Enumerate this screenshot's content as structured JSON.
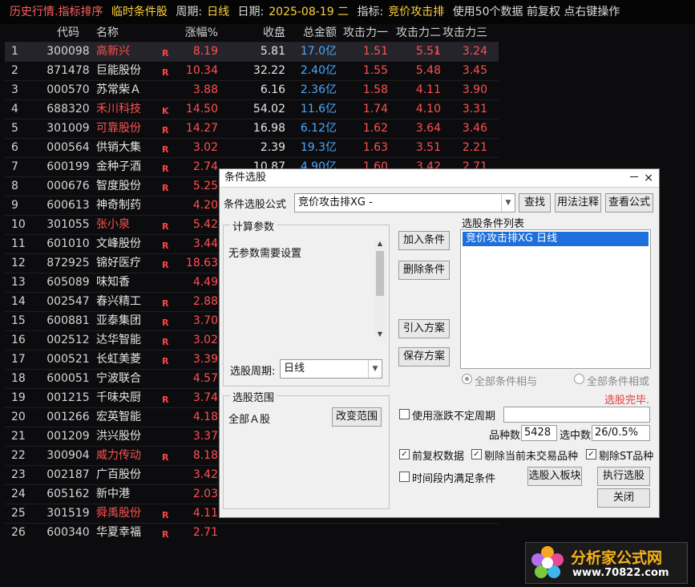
{
  "topbar": {
    "title": "历史行情.指标排序",
    "condition": "临时条件股",
    "period_label": "周期:",
    "period_value": "日线",
    "date_label": "日期:",
    "date_value": "2025-08-19 二",
    "indicator_label": "指标:",
    "indicator_value": "竞价攻击排",
    "info": "使用50个数据 前复权 点右键操作"
  },
  "table": {
    "headers": [
      "",
      "代码",
      "名称",
      "",
      "涨幅%",
      "收盘",
      "总金额",
      "攻击力一",
      "攻击力二",
      "攻击力三"
    ],
    "sort_arrow": "↓",
    "rows": [
      {
        "n": "1",
        "code": "300098",
        "name": "高新兴",
        "flag": "R",
        "chg": "8.19",
        "close": "5.81",
        "amt": "17.0亿",
        "a1": "1.51",
        "a2": "5.51",
        "a3": "3.24",
        "name_red": true
      },
      {
        "n": "2",
        "code": "871478",
        "name": "巨能股份",
        "flag": "R",
        "chg": "10.34",
        "close": "32.22",
        "amt": "2.40亿",
        "a1": "1.55",
        "a2": "5.48",
        "a3": "3.45",
        "name_red": false
      },
      {
        "n": "3",
        "code": "000570",
        "name": "苏常柴Ａ",
        "flag": "",
        "chg": "3.88",
        "close": "6.16",
        "amt": "2.36亿",
        "a1": "1.58",
        "a2": "4.11",
        "a3": "3.90",
        "name_red": false
      },
      {
        "n": "4",
        "code": "688320",
        "name": "禾川科技",
        "flag": "K",
        "chg": "14.50",
        "close": "54.02",
        "amt": "11.6亿",
        "a1": "1.74",
        "a2": "4.10",
        "a3": "3.31",
        "name_red": true
      },
      {
        "n": "5",
        "code": "301009",
        "name": "可靠股份",
        "flag": "R",
        "chg": "14.27",
        "close": "16.98",
        "amt": "6.12亿",
        "a1": "1.62",
        "a2": "3.64",
        "a3": "3.46",
        "name_red": true
      },
      {
        "n": "6",
        "code": "000564",
        "name": "供销大集",
        "flag": "R",
        "chg": "3.02",
        "close": "2.39",
        "amt": "19.3亿",
        "a1": "1.63",
        "a2": "3.51",
        "a3": "2.21",
        "name_red": false
      },
      {
        "n": "7",
        "code": "600199",
        "name": "金种子酒",
        "flag": "R",
        "chg": "2.74",
        "close": "10.87",
        "amt": "4.90亿",
        "a1": "1.60",
        "a2": "3.42",
        "a3": "2.71",
        "name_red": false
      },
      {
        "n": "8",
        "code": "000676",
        "name": "智度股份",
        "flag": "R",
        "chg": "5.25",
        "close": "",
        "amt": "",
        "a1": "",
        "a2": "",
        "a3": "",
        "name_red": false
      },
      {
        "n": "9",
        "code": "600613",
        "name": "神奇制药",
        "flag": "",
        "chg": "4.20",
        "close": "",
        "amt": "",
        "a1": "",
        "a2": "",
        "a3": "",
        "name_red": false
      },
      {
        "n": "10",
        "code": "301055",
        "name": "张小泉",
        "flag": "R",
        "chg": "5.42",
        "close": "",
        "amt": "",
        "a1": "",
        "a2": "",
        "a3": "",
        "name_red": true
      },
      {
        "n": "11",
        "code": "601010",
        "name": "文峰股份",
        "flag": "R",
        "chg": "3.44",
        "close": "",
        "amt": "",
        "a1": "",
        "a2": "",
        "a3": "",
        "name_red": false
      },
      {
        "n": "12",
        "code": "872925",
        "name": "锦好医疗",
        "flag": "R",
        "chg": "18.63",
        "close": "",
        "amt": "",
        "a1": "",
        "a2": "",
        "a3": "",
        "name_red": false
      },
      {
        "n": "13",
        "code": "605089",
        "name": "味知香",
        "flag": "",
        "chg": "4.49",
        "close": "",
        "amt": "",
        "a1": "",
        "a2": "",
        "a3": "",
        "name_red": false
      },
      {
        "n": "14",
        "code": "002547",
        "name": "春兴精工",
        "flag": "R",
        "chg": "2.88",
        "close": "",
        "amt": "",
        "a1": "",
        "a2": "",
        "a3": "",
        "name_red": false
      },
      {
        "n": "15",
        "code": "600881",
        "name": "亚泰集团",
        "flag": "R",
        "chg": "3.70",
        "close": "",
        "amt": "",
        "a1": "",
        "a2": "",
        "a3": "",
        "name_red": false
      },
      {
        "n": "16",
        "code": "002512",
        "name": "达华智能",
        "flag": "R",
        "chg": "3.02",
        "close": "",
        "amt": "",
        "a1": "",
        "a2": "",
        "a3": "",
        "name_red": false
      },
      {
        "n": "17",
        "code": "000521",
        "name": "长虹美菱",
        "flag": "R",
        "chg": "3.39",
        "close": "",
        "amt": "",
        "a1": "",
        "a2": "",
        "a3": "",
        "name_red": false
      },
      {
        "n": "18",
        "code": "600051",
        "name": "宁波联合",
        "flag": "",
        "chg": "4.57",
        "close": "",
        "amt": "",
        "a1": "",
        "a2": "",
        "a3": "",
        "name_red": false
      },
      {
        "n": "19",
        "code": "001215",
        "name": "千味央厨",
        "flag": "R",
        "chg": "3.74",
        "close": "",
        "amt": "",
        "a1": "",
        "a2": "",
        "a3": "",
        "name_red": false
      },
      {
        "n": "20",
        "code": "001266",
        "name": "宏英智能",
        "flag": "",
        "chg": "4.18",
        "close": "",
        "amt": "",
        "a1": "",
        "a2": "",
        "a3": "",
        "name_red": false
      },
      {
        "n": "21",
        "code": "001209",
        "name": "洪兴股份",
        "flag": "",
        "chg": "3.37",
        "close": "",
        "amt": "",
        "a1": "",
        "a2": "",
        "a3": "",
        "name_red": false
      },
      {
        "n": "22",
        "code": "300904",
        "name": "威力传动",
        "flag": "R",
        "chg": "8.18",
        "close": "",
        "amt": "",
        "a1": "",
        "a2": "",
        "a3": "",
        "name_red": true
      },
      {
        "n": "23",
        "code": "002187",
        "name": "广百股份",
        "flag": "",
        "chg": "3.42",
        "close": "",
        "amt": "",
        "a1": "",
        "a2": "",
        "a3": "",
        "name_red": false
      },
      {
        "n": "24",
        "code": "605162",
        "name": "新中港",
        "flag": "",
        "chg": "2.03",
        "close": "",
        "amt": "",
        "a1": "",
        "a2": "",
        "a3": "",
        "name_red": false
      },
      {
        "n": "25",
        "code": "301519",
        "name": "舜禹股份",
        "flag": "R",
        "chg": "4.11",
        "close": "",
        "amt": "",
        "a1": "",
        "a2": "",
        "a3": "",
        "name_red": true
      },
      {
        "n": "26",
        "code": "600340",
        "name": "华夏幸福",
        "flag": "R",
        "chg": "2.71",
        "close": "",
        "amt": "",
        "a1": "",
        "a2": "",
        "a3": "",
        "name_red": false
      }
    ]
  },
  "dialog": {
    "title": "条件选股",
    "minimize": "－",
    "close": "×",
    "formula_label": "条件选股公式",
    "formula_value": "竞价攻击排XG  -",
    "find_btn": "查找",
    "usage_btn": "用法注释",
    "view_btn": "查看公式",
    "params_title": "计算参数",
    "params_text": "无参数需要设置",
    "period_label": "选股周期:",
    "period_value": "日线",
    "range_title": "选股范围",
    "range_value": "全部Ａ股",
    "change_range_btn": "改变范围",
    "add_cond_btn": "加入条件",
    "del_cond_btn": "删除条件",
    "import_btn": "引入方案",
    "save_btn": "保存方案",
    "list_title": "选股条件列表",
    "list_items": [
      "竞价攻击排XG  日线"
    ],
    "radio_and": "全部条件相与",
    "radio_or": "全部条件相或",
    "status": "选股完毕.",
    "use_uncertain": "使用涨跌不定周期",
    "count_label": "品种数",
    "count_value": "5428",
    "selected_label": "选中数",
    "selected_value": "26/0.5%",
    "chk_fq": "前复权数据",
    "chk_exclude_untraded": "剔除当前未交易品种",
    "chk_exclude_st": "剔除ST品种",
    "chk_period_satisfy": "时间段内满足条件",
    "to_block_btn": "选股入板块",
    "execute_btn": "执行选股",
    "close_btn": "关闭"
  },
  "logo": {
    "name": "分析家公式网",
    "url": "www.70822.com"
  },
  "colors": {
    "up": "#ff5050",
    "amount": "#4aa8ff",
    "selection": "#1e6fdb"
  }
}
